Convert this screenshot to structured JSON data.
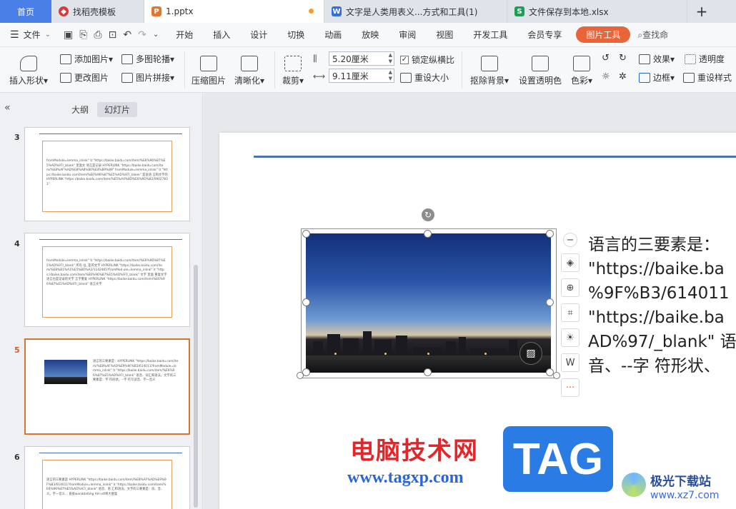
{
  "tabs": {
    "home": "首页",
    "items": [
      {
        "label": "找稻壳模板",
        "icon": "docer-icon",
        "color": "#d93a3a"
      },
      {
        "label": "1.pptx",
        "icon": "ppt-icon",
        "color": "#e8742c",
        "unsaved": true
      },
      {
        "label": "文字是人类用表义...方式和工具(1)",
        "icon": "word-icon",
        "color": "#2f6fe0"
      },
      {
        "label": "文件保存到本地.xlsx",
        "icon": "excel-icon",
        "color": "#1f9d55"
      }
    ],
    "new_tab": "+"
  },
  "menu": {
    "file": "文件",
    "tabs": [
      "开始",
      "插入",
      "设计",
      "切换",
      "动画",
      "放映",
      "审阅",
      "视图",
      "开发工具",
      "会员专享"
    ],
    "active_tab": "图片工具",
    "search": "查找命"
  },
  "ribbon": {
    "insert_shape": "插入形状",
    "add_picture": "添加图片",
    "change_picture": "更改图片",
    "multi_carousel": "多图轮播",
    "picture_collage": "图片拼接",
    "compress": "压缩图片",
    "sharpen": "清晰化",
    "crop": "裁剪",
    "width": "5.20厘米",
    "height": "9.11厘米",
    "lock_ratio": "锁定纵横比",
    "reset_size": "重设大小",
    "remove_bg": "抠除背景",
    "set_transparent": "设置透明色",
    "color": "色彩",
    "effects": "效果",
    "transparency": "透明度",
    "border": "边框",
    "reset_style": "重设样式"
  },
  "panel": {
    "outline_tab": "大纲",
    "slides_tab": "幻灯片",
    "slides": [
      {
        "num": "3",
        "text": "fromModule=lemma_inlink\" \\t \"https://baike.baidu.com/item/%E6%96%87%E5%AD%97/_blank\" 里面文 语言是记录 HYPERLINK \"https://baike.baidu.com/item/%E8%AF%AD%E8%A8%80%E4%B9%89\" fromModule=lemma_inlink\" \\t \"https://baike.baidu.com/item/%E6%96%87%E5%AD%97/_blank\" 是说语 言和文字的 HYPERLINK \"https://baike.baidu.com/item/%E5%A4%8D%E6%9D%82/09027831\""
      },
      {
        "num": "4",
        "text": "fromModule=lemma_inlink\" \\t \"https://baike.baidu.com/item/%E6%96%87%E5%AD%97/_blank\" 所有 址, 是的文字 HYPERLINK \"https://baike.baidu.com/item/%E8%B1%A1%E5%BD%A2/1142465?fromMod ule=lemma_inlink\" \\t \"https://baike.baidu.com/item/%E6%96%87%E5%AD%97/_blank\" 文字 里面 重复文字语言也是记录的文字 言字重复 HYPERLINK \"https://baike.baidu.com/item/%E6%96%87%E5%AD%97/_blank\" 语言文字"
      },
      {
        "num": "5",
        "text": "语言的三要素是：HYPERLINK \"https://baike.baidu.com/item/%E8%AF%AD%E9%9F%B3/614011?fromModule=lemma_inlink\" \\t \"https://baike.baidu.com/item/%E6%96%87%E5%AD%97/_blank\" 语音、词汇和语法。文字的三要素是：字 符形状、--字 符写读音、字一音义"
      },
      {
        "num": "6",
        "text": "语言的三要素是 HYPERLINK \"https://baike.baidu.com/item/%E8%AF%AD%E9%9F%B3/614011?fromModule=lemma_inlink\" \\t \"https://baike.baidu.com/item/%E6%96%87%E5%AD%97/_blank\" 语音、语 汇和语法。文字的三要素是：形、音、义。字一音义... 直接wanddafahg AH vdf将大图鉴"
      }
    ]
  },
  "slide": {
    "text_lines": [
      "语言的三要素是：",
      "\"https://baike.ba",
      "%9F%B3/614011",
      "\"https://baike.ba",
      "AD%97/_blank\" 语",
      "音、--字 符形状、"
    ]
  },
  "watermark": {
    "cn": "电脑技术网",
    "url": "www.tagxp.com",
    "tag": "TAG",
    "jg_cn": "极光下载站",
    "jg_url": "www.xz7.com"
  }
}
